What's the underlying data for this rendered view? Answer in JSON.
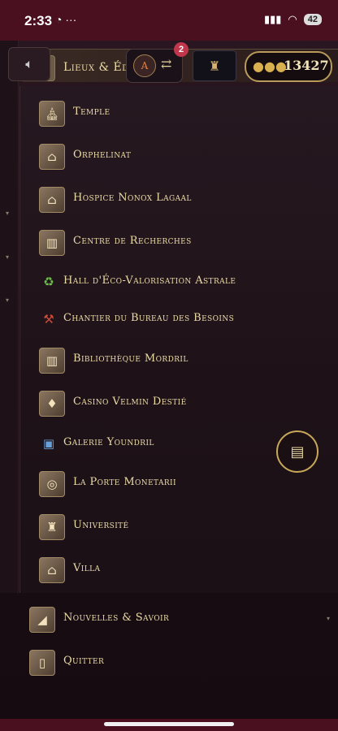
{
  "status_bar": {
    "time": "2:33",
    "battery": "42"
  },
  "header": {
    "section_label": "Lieux & Éd",
    "notification_count": "2",
    "coins": "13427"
  },
  "menu": {
    "items": [
      {
        "label": "Temple",
        "icon": "temple-icon"
      },
      {
        "label": "Orphelinat",
        "icon": "orphanage-icon"
      },
      {
        "label": "Hospice Nonox Lagaal",
        "icon": "hospice-icon"
      },
      {
        "label": "Centre de Recherches",
        "icon": "research-icon"
      },
      {
        "label": "Hall d'Éco-Valorisation Astrale",
        "icon": "recycle-icon"
      },
      {
        "label": "Chantier du Bureau des Besoins",
        "icon": "crane-icon"
      },
      {
        "label": "Bibliothèque Mordril",
        "icon": "library-icon"
      },
      {
        "label": "Casino Velmin Destié",
        "icon": "casino-icon"
      },
      {
        "label": "Galerie Youndril",
        "icon": "gallery-icon"
      },
      {
        "label": "La Porte Monetarii",
        "icon": "portal-icon"
      },
      {
        "label": "Université",
        "icon": "university-icon"
      },
      {
        "label": "Villa",
        "icon": "villa-icon"
      }
    ]
  },
  "bottom": {
    "news_label": "Nouvelles & Savoir",
    "quit_label": "Quitter"
  }
}
